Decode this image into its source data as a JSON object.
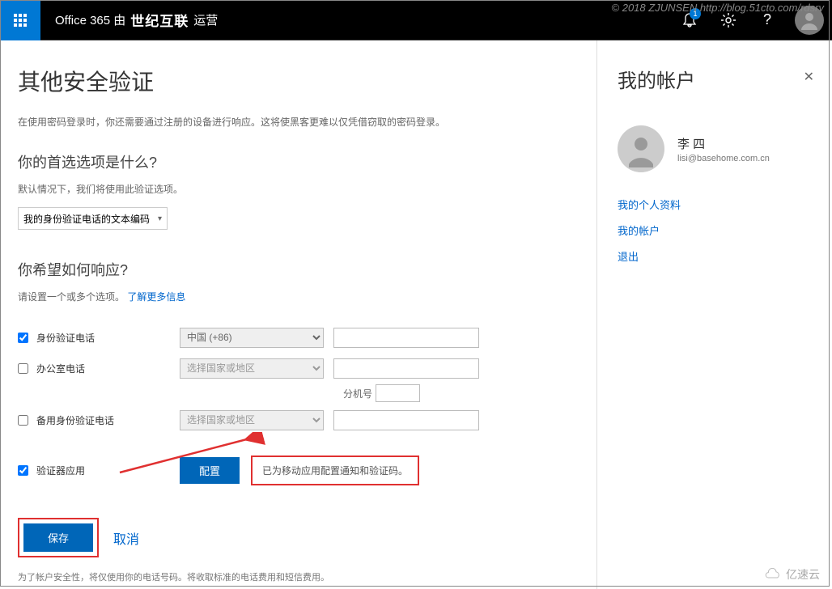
{
  "watermark": {
    "top": "© 2018 ZJUNSEN http://blog.51cto.com/rdsrv",
    "bottom": "亿速云"
  },
  "topbar": {
    "brand_prefix": "Office 365 由",
    "brand_logo": "世纪互联",
    "brand_suffix": "运营",
    "notification_count": "1"
  },
  "main": {
    "title": "其他安全验证",
    "description": "在使用密码登录时，你还需要通过注册的设备进行响应。这将使黑客更难以仅凭借窃取的密码登录。",
    "pref_title": "你的首选选项是什么?",
    "pref_sub": "默认情况下，我们将使用此验证选项。",
    "pref_select": "我的身份验证电话的文本编码",
    "respond_title": "你希望如何响应?",
    "respond_sub_prefix": "请设置一个或多个选项。",
    "respond_link": "了解更多信息",
    "options": {
      "auth_phone": {
        "label": "身份验证电话",
        "country": "中国 (+86)",
        "checked": true
      },
      "office_phone": {
        "label": "办公室电话",
        "placeholder": "选择国家或地区",
        "checked": false
      },
      "ext_label": "分机号",
      "alt_phone": {
        "label": "备用身份验证电话",
        "placeholder": "选择国家或地区",
        "checked": false
      },
      "authenticator": {
        "label": "验证器应用",
        "checked": true
      }
    },
    "configure_btn": "配置",
    "status_message": "已为移动应用配置通知和验证码。",
    "save_btn": "保存",
    "cancel_link": "取消",
    "footnote": "为了帐户安全性，将仅使用你的电话号码。将收取标准的电话费用和短信费用。"
  },
  "sidebar": {
    "title": "我的帐户",
    "user": {
      "name": "李 四",
      "email": "lisi@basehome.com.cn"
    },
    "links": {
      "profile": "我的个人资料",
      "account": "我的帐户",
      "signout": "退出"
    }
  }
}
